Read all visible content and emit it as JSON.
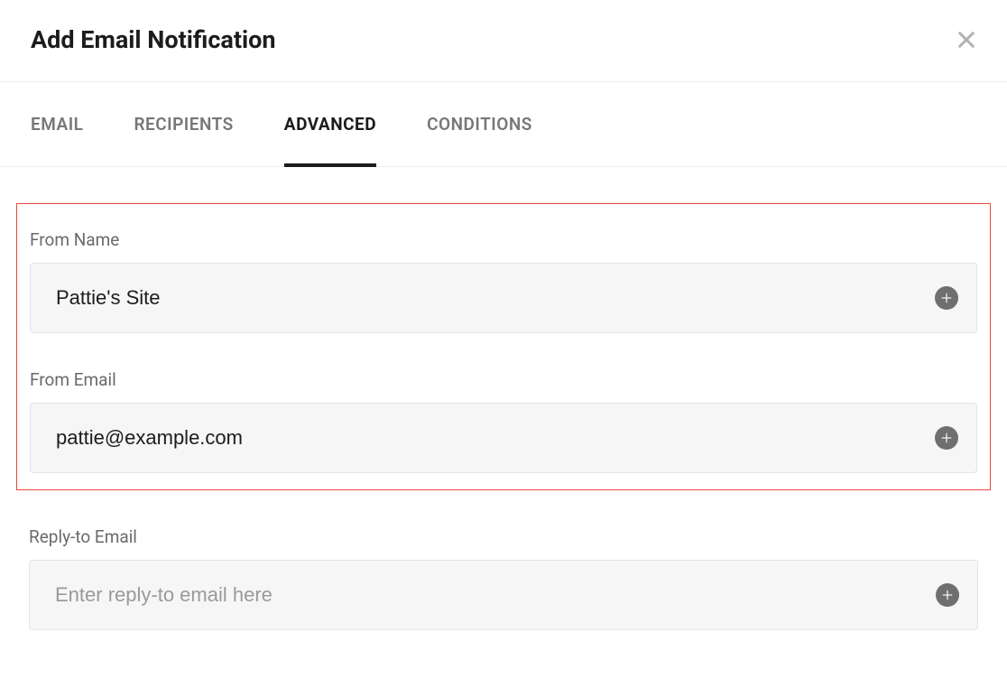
{
  "header": {
    "title": "Add Email Notification"
  },
  "tabs": {
    "email": "EMAIL",
    "recipients": "RECIPIENTS",
    "advanced": "ADVANCED",
    "conditions": "CONDITIONS"
  },
  "fields": {
    "fromName": {
      "label": "From Name",
      "value": "Pattie's Site"
    },
    "fromEmail": {
      "label": "From Email",
      "value": "pattie@example.com"
    },
    "replyTo": {
      "label": "Reply-to Email",
      "placeholder": "Enter reply-to email here",
      "value": ""
    }
  }
}
